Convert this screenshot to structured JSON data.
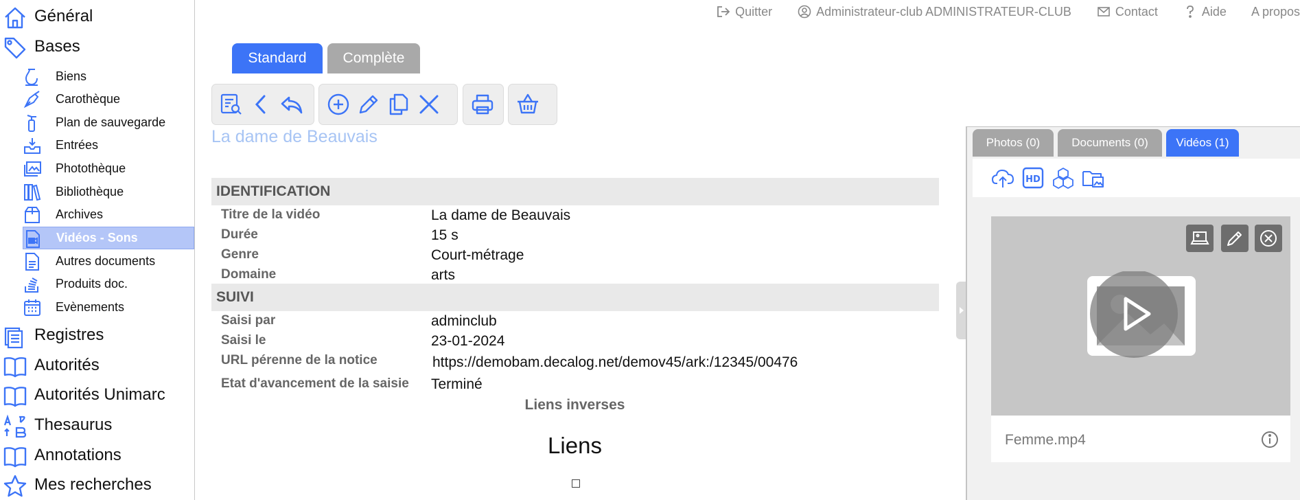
{
  "colors": {
    "accent": "#3c74f7",
    "tab_inactive": "#a9a9a9",
    "sidebar_active": "#b4c6f8",
    "section_bg": "#e9e9e9",
    "title_light": "#a7c4f4"
  },
  "sidebar": {
    "top_items": [
      {
        "label": "Général",
        "icon": "home-icon"
      },
      {
        "label": "Bases",
        "icon": "tag-icon"
      }
    ],
    "sub_items": [
      {
        "label": "Biens",
        "icon": "vase-icon"
      },
      {
        "label": "Carothèque",
        "icon": "pen-nib-icon"
      },
      {
        "label": "Plan de sauvegarde",
        "icon": "fire-extinguisher-icon"
      },
      {
        "label": "Entrées",
        "icon": "inbox-download-icon"
      },
      {
        "label": "Photothèque",
        "icon": "photo-icon"
      },
      {
        "label": "Bibliothèque",
        "icon": "books-icon"
      },
      {
        "label": "Archives",
        "icon": "box-icon"
      },
      {
        "label": "Vidéos - Sons",
        "icon": "video-file-icon",
        "active": true
      },
      {
        "label": "Autres documents",
        "icon": "document-icon"
      },
      {
        "label": "Produits doc.",
        "icon": "stack-icon"
      },
      {
        "label": "Evènements",
        "icon": "calendar-icon"
      }
    ],
    "bottom_items": [
      {
        "label": "Registres",
        "icon": "registers-icon"
      },
      {
        "label": "Autorités",
        "icon": "open-book-icon"
      },
      {
        "label": "Autorités Unimarc",
        "icon": "open-book-icon"
      },
      {
        "label": "Thesaurus",
        "icon": "sort-az-icon"
      },
      {
        "label": "Annotations",
        "icon": "open-book-icon"
      },
      {
        "label": "Mes recherches",
        "icon": "star-icon"
      }
    ]
  },
  "topbar": {
    "quit": "Quitter",
    "user": "Administrateur-club ADMINISTRATEUR-CLUB",
    "contact": "Contact",
    "help": "Aide",
    "about": "A propos"
  },
  "mode_tabs": {
    "standard": "Standard",
    "complete": "Complète"
  },
  "record": {
    "title": "La dame de Beauvais",
    "sections": [
      {
        "heading": "IDENTIFICATION",
        "rows": [
          {
            "label": "Titre de la vidéo",
            "value": "La dame de Beauvais"
          },
          {
            "label": "Durée",
            "value": "15 s"
          },
          {
            "label": "Genre",
            "value": "Court-métrage"
          },
          {
            "label": "Domaine",
            "value": "arts"
          }
        ]
      },
      {
        "heading": "SUIVI",
        "rows": [
          {
            "label": "Saisi par",
            "value": "adminclub"
          },
          {
            "label": "Saisi le",
            "value": "23-01-2024"
          },
          {
            "label": "URL pérenne de la notice",
            "value": "https://demobam.decalog.net/demov45/ark:/12345/00476"
          },
          {
            "label": "Etat d'avancement de la saisie",
            "value": "Terminé"
          }
        ]
      }
    ],
    "liens_inverses": "Liens inverses",
    "liens_title": "Liens"
  },
  "media_panel": {
    "tabs": {
      "photos": "Photos (0)",
      "documents": "Documents (0)",
      "videos": "Vidéos (1)"
    },
    "active_tab": "videos",
    "video": {
      "filename": "Femme.mp4"
    }
  }
}
